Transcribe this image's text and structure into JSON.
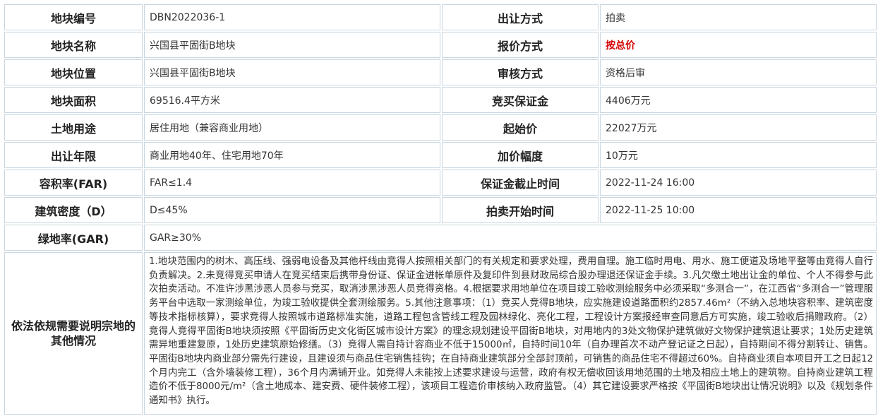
{
  "rows": [
    {
      "l1": "地块编号",
      "v1": "DBN2022036-1",
      "l2": "出让方式",
      "v2": "拍卖"
    },
    {
      "l1": "地块名称",
      "v1": "兴国县平固街B地块",
      "l2": "报价方式",
      "v2": "按总价"
    },
    {
      "l1": "地块位置",
      "v1": "兴国县平固街B地块",
      "l2": "审核方式",
      "v2": "资格后审"
    },
    {
      "l1": "地块面积",
      "v1": "69516.4平方米",
      "l2": "竞买保证金",
      "v2": "4406万元"
    },
    {
      "l1": "土地用途",
      "v1": "居住用地（兼容商业用地）",
      "l2": "起始价",
      "v2": "22027万元"
    },
    {
      "l1": "出让年限",
      "v1": "商业用地40年、住宅用地70年",
      "l2": "加价幅度",
      "v2": "10万元"
    },
    {
      "l1": "容积率(FAR)",
      "v1": "FAR≤1.4",
      "l2": "保证金截止时间",
      "v2": "2022-11-24 16:00"
    },
    {
      "l1": "建筑密度（D）",
      "v1": "D≤45%",
      "l2": "拍卖开始时间",
      "v2": "2022-11-25 10:00"
    }
  ],
  "green": {
    "label": "绿地率(GAR)",
    "value": "GAR≥30%"
  },
  "note": {
    "label": "依法依规需要说明宗地的其他情况",
    "text": "1.地块范围内的树木、高压线、强弱电设备及其他杆线由竞得人按照相关部门的有关规定和要求处理，费用自理。施工临时用电、用水、施工便道及场地平整等由竞得人自行负责解决。2.未竞得竞买申请人在竞买结束后携带身份证、保证金进帐单原件及复印件到县财政局综合股办理退还保证金手续。3.凡欠缴土地出让金的单位、个人不得参与此次拍卖活动。不准许涉黑涉恶人员参与竞买，取消涉黑涉恶人员竞得资格。4.根据要求用地单位在项目竣工验收测绘服务中必须采取“多测合一”，在江西省“多测合一”管理服务平台中选取一家测绘单位，为竣工验收提供全套测绘服务。5.其他注意事项：（1）竞买人竞得B地块，应实施建设道路面积约2857.46m²（不纳入总地块容积率、建筑密度等技术指标核算），要求竞得人按照城市道路标准实施，道路工程包含管线工程及园林绿化、亮化工程，工程设计方案报经审查同意后方可实施，竣工验收后捐赠政府。（2）竞得人竞得平固街B地块须按照《平固街历史文化街区城市设计方案》的理念规划建设平固街B地块，对用地内的3处文物保护建筑做好文物保护建筑退让要求；1处历史建筑需异地重建复原，1处历史建筑原始修缮。（3）竞得人需自持计容商业不低于15000㎡，自持时间10年（自办理首次不动产登记证之日起），自持期间不得分割转让、销售。平固街B地块内商业部分需先行建设，且建设须与商品住宅销售挂钩；在自持商业建筑部分全部封顶前，可销售的商品住宅不得超过60%。自持商业须自本项目开工之日起12个月内完工（含外墙装修工程），36个月内满铺开业。如竞得人未能按上述要求建设与运营，政府有权无偿收回该用地范围的土地及相应土地上的建筑物。自持商业建筑工程造价不低于8000元/m²（含土地成本、建安费、硬件装修工程），该项目工程造价审核纳入政府监管。（4）其它建设要求严格按《平固街B地块出让情况说明》以及《规划条件通知书》执行。"
  },
  "highlight_color": "#d40000"
}
